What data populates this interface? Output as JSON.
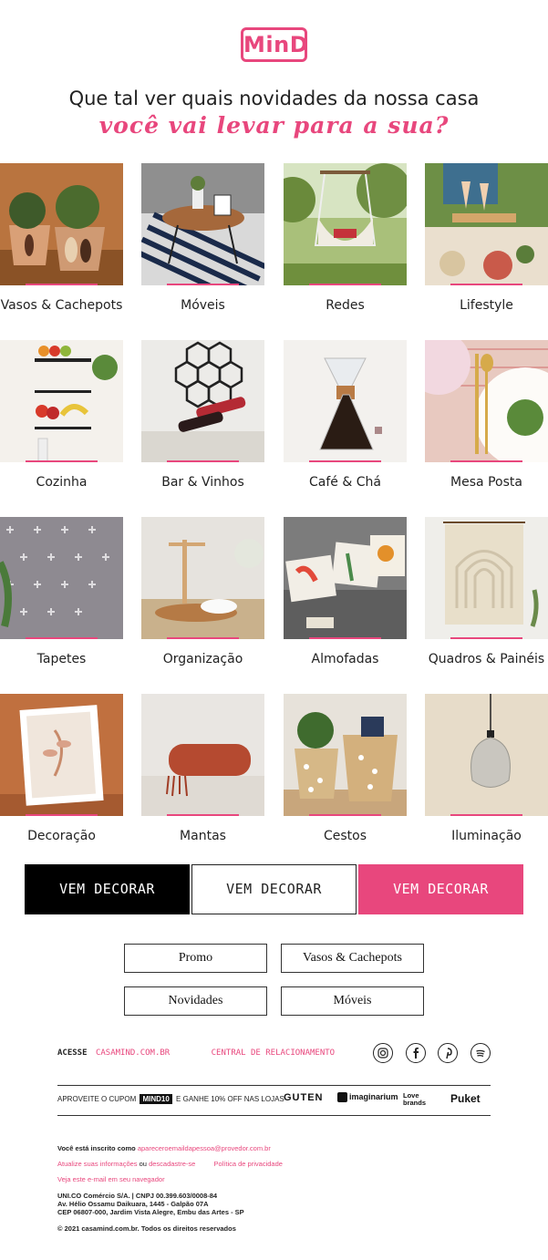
{
  "logo": {
    "text": "MinD"
  },
  "headline": "Que tal ver quais novidades da nossa casa",
  "tagline": "você vai levar para a sua?",
  "categories": [
    {
      "label": "Vasos & Cachepots"
    },
    {
      "label": "Móveis"
    },
    {
      "label": "Redes"
    },
    {
      "label": "Lifestyle"
    },
    {
      "label": "Cozinha"
    },
    {
      "label": "Bar & Vinhos"
    },
    {
      "label": "Café & Chá"
    },
    {
      "label": "Mesa Posta"
    },
    {
      "label": "Tapetes"
    },
    {
      "label": "Organização"
    },
    {
      "label": "Almofadas"
    },
    {
      "label": "Quadros & Painéis"
    },
    {
      "label": "Decoração"
    },
    {
      "label": "Mantas"
    },
    {
      "label": "Cestos"
    },
    {
      "label": "Iluminação"
    }
  ],
  "cta": {
    "black": "VEM DECORAR",
    "white": "VEM DECORAR",
    "pink": "VEM DECORAR"
  },
  "pills": [
    "Promo",
    "Vasos & Cachepots",
    "Novidades",
    "Móveis"
  ],
  "footer": {
    "acesse_label": "ACESSE",
    "site": "CASAMIND.COM.BR",
    "central": "CENTRAL DE RELACIONAMENTO",
    "promo_prefix": "APROVEITE O CUPOM",
    "coupon": "MIND10",
    "promo_suffix": "E GANHE 10% OFF NAS LOJAS",
    "brands": [
      "GUTEN",
      "imaginarium",
      "Love brands",
      "Puket"
    ],
    "subscribed_prefix": "Você está inscrito como",
    "email": "apareceroemaildapessoa@provedor.com.br",
    "update_info": "Atualize suas informações",
    "or": "ou",
    "unsubscribe": "descadastre-se",
    "privacy": "Política de privacidade",
    "browser": "Veja este e-mail em seu navegador",
    "company1": "UNI.CO Comércio S/A. | CNPJ 00.399.603/0008-84",
    "company2": "Av. Hélio Ossamu Daikuara, 1445 - Galpão 07A",
    "company3": "CEP 06807-000, Jardim Vista Alegre, Embu das Artes - SP",
    "copyright": "© 2021 casamind.com.br. Todos os direitos reservados"
  },
  "colors": {
    "accent": "#e8477d",
    "black": "#000000"
  }
}
